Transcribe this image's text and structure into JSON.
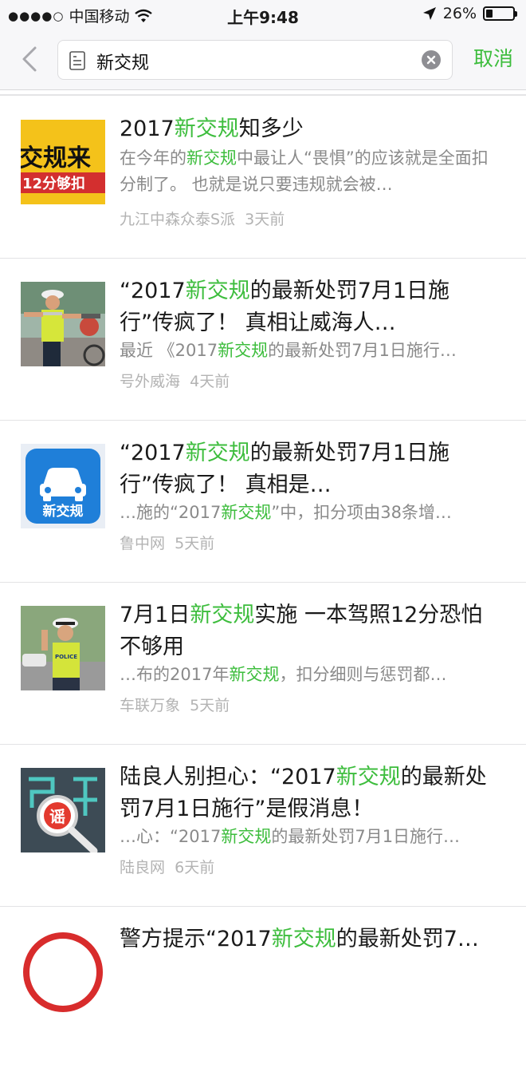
{
  "status_bar": {
    "signal": "●●●●○",
    "carrier": "中国移动",
    "time": "上午9:48",
    "battery_text": "26%",
    "battery_level": 0.26
  },
  "search": {
    "query": "新交规",
    "cancel_label": "取消"
  },
  "results": [
    {
      "title": [
        "2017",
        "新交规",
        "知多少"
      ],
      "snippet": [
        "在今年的",
        "新交规",
        "中最让人“畏惧”的应该就是全面扣分制了。 也就是说只要违规就会被…"
      ],
      "source": "九江中森众泰S派",
      "time": "3天前",
      "thumb": "traffic-rules-banner",
      "thumb_text": [
        "交规来",
        "12分够扣"
      ]
    },
    {
      "title": [
        "“2017",
        "新交规",
        "的最新处罚7月1日施行”传疯了！ 真相让威海人…"
      ],
      "snippet": [
        "最近 《2017",
        "新交规",
        "的最新处罚7月1日施行…"
      ],
      "source": "号外威海",
      "time": "4天前",
      "thumb": "traffic-police-photo"
    },
    {
      "title": [
        "“2017",
        "新交规",
        "的最新处罚7月1日施行”传疯了！ 真相是…"
      ],
      "snippet": [
        "…施的“2017",
        "新交规",
        "”中，扣分项由38条增…"
      ],
      "source": "鲁中网",
      "time": "5天前",
      "thumb": "car-app-icon",
      "thumb_text": [
        "新交规"
      ]
    },
    {
      "title": [
        "7月1日",
        "新交规",
        "实施 一本驾照12分恐怕不够用"
      ],
      "snippet": [
        "…布的2017年",
        "新交规",
        "，扣分细则与惩罚都…"
      ],
      "source": "车联万象",
      "time": "5天前",
      "thumb": "police-officer-photo",
      "thumb_text": [
        "POLICE"
      ]
    },
    {
      "title": [
        "陆良人别担心：“2017",
        "新交规",
        "的最新处罚7月1日施行”是假消息！"
      ],
      "snippet": [
        "…心：“2017",
        "新交规",
        "的最新处罚7月1日施行…"
      ],
      "source": "陆良网",
      "time": "6天前",
      "thumb": "rumor-magnifier-icon",
      "thumb_text": [
        "谣"
      ]
    },
    {
      "title": [
        "警方提示“2017",
        "新交规",
        "的最新处罚7…"
      ],
      "thumb": "police-warning-icon"
    }
  ],
  "colors": {
    "accent": "#3dbd3d",
    "snippet": "#8a8a8a",
    "meta": "#b3b3b3"
  }
}
